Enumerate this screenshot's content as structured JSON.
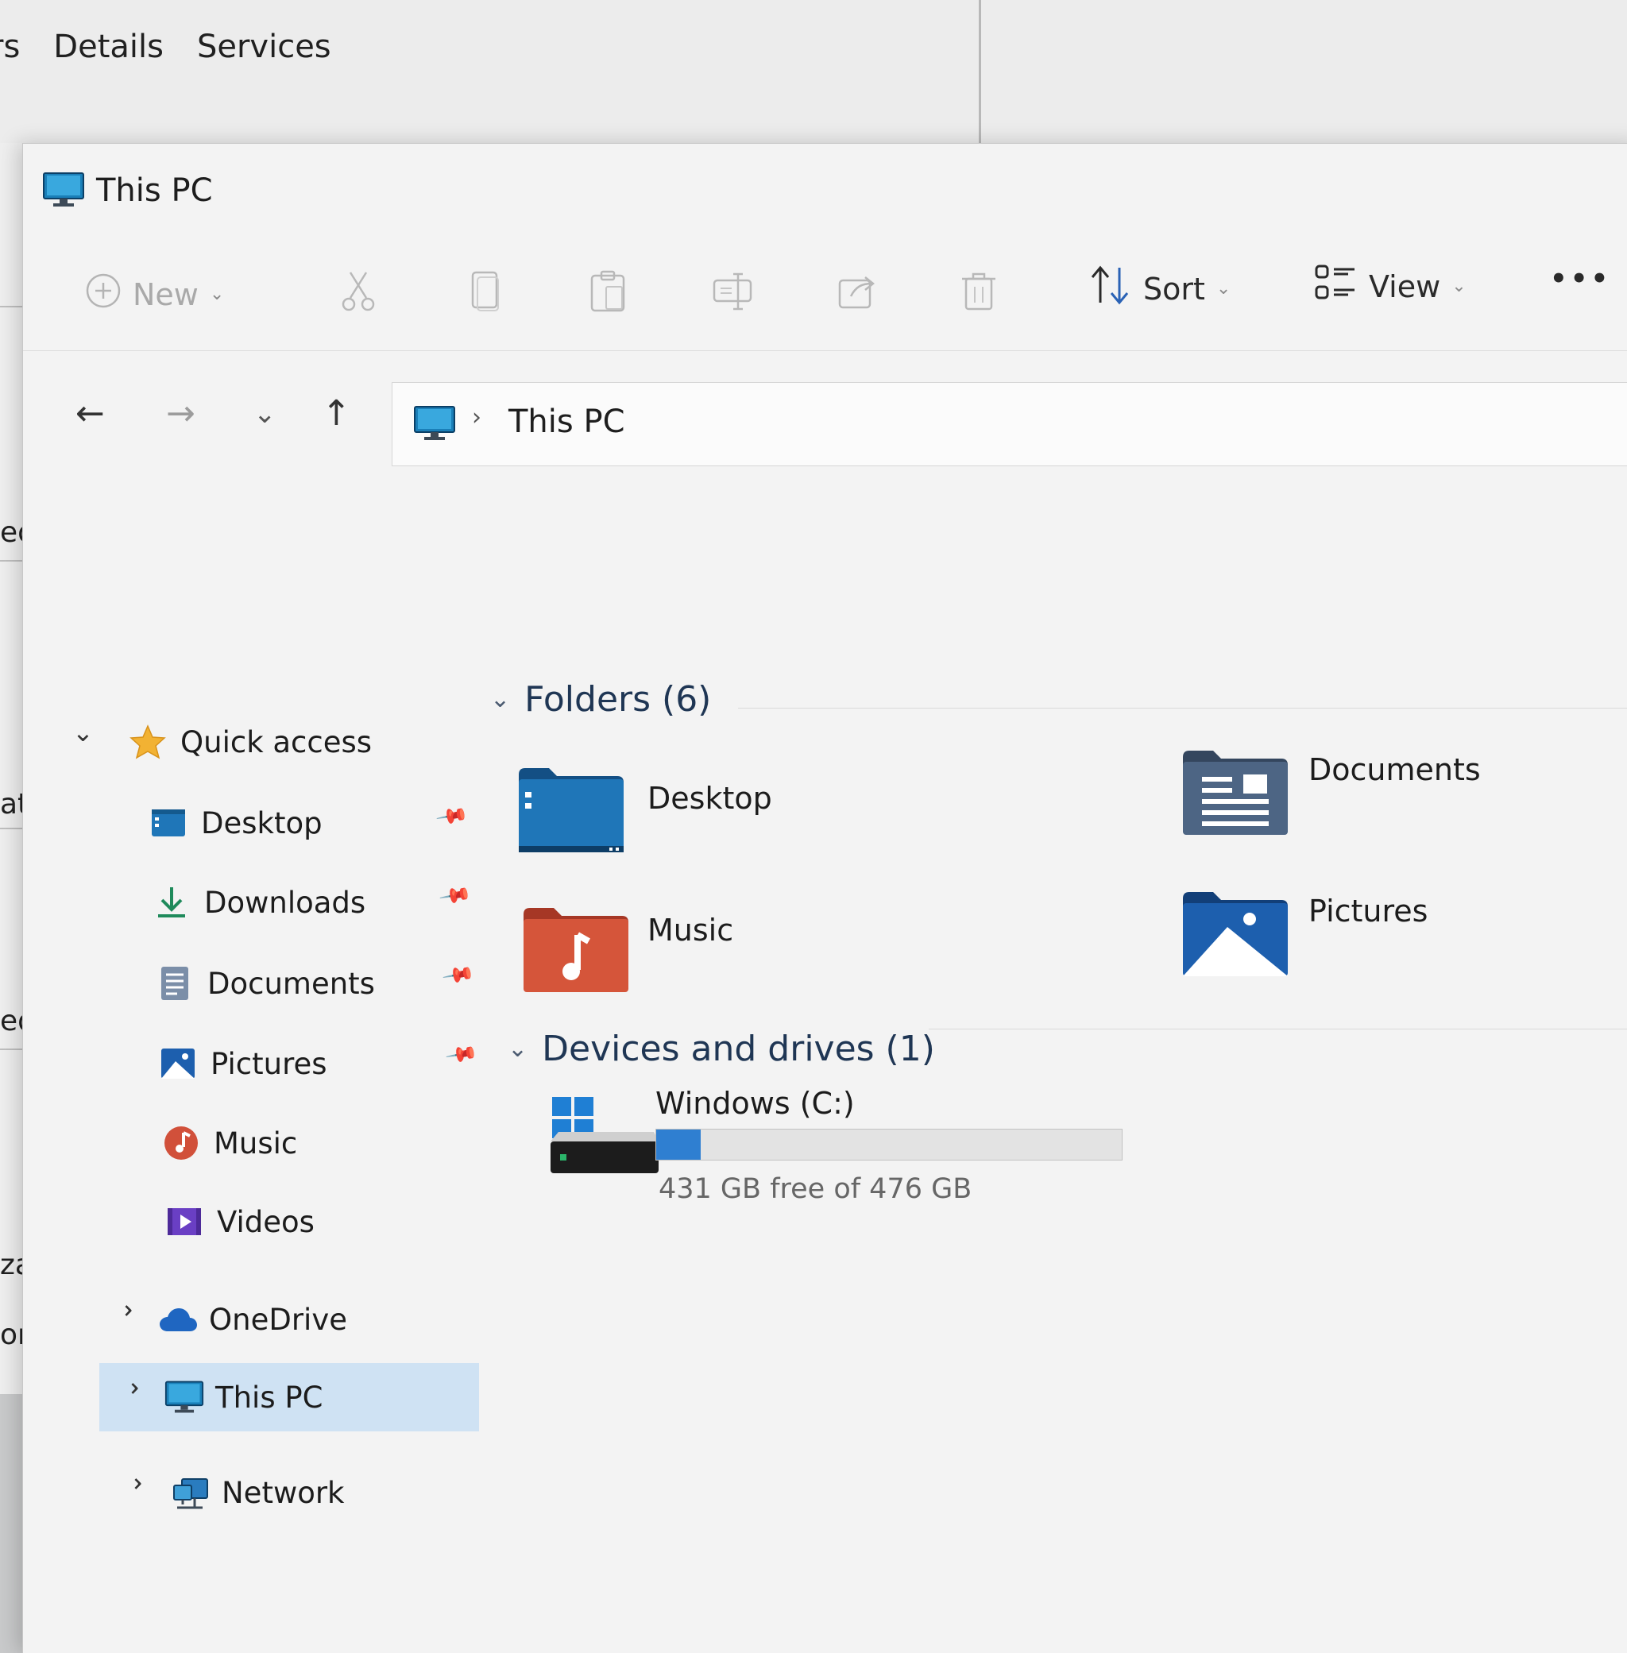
{
  "taskmgr": {
    "tabs": [
      "rs",
      "Details",
      "Services"
    ],
    "fragments": [
      "eo l",
      "ated",
      "ed GPl",
      "zation",
      "or"
    ]
  },
  "window": {
    "title": "This PC"
  },
  "toolbar": {
    "new_label": "New",
    "sort_label": "Sort",
    "view_label": "View",
    "more_label": "•••"
  },
  "nav": {
    "back": "←",
    "forward": "→",
    "recent": "⌄",
    "up": "↑",
    "separator": "›",
    "address": "This PC"
  },
  "sidebar": {
    "quick_access": "Quick access",
    "items": [
      {
        "label": "Desktop",
        "pinned": true
      },
      {
        "label": "Downloads",
        "pinned": true
      },
      {
        "label": "Documents",
        "pinned": true
      },
      {
        "label": "Pictures",
        "pinned": true
      },
      {
        "label": "Music",
        "pinned": false
      },
      {
        "label": "Videos",
        "pinned": false
      }
    ],
    "onedrive": "OneDrive",
    "thispc": "This PC",
    "network": "Network"
  },
  "content": {
    "folders_header": "Folders (6)",
    "folders": [
      {
        "label": "Desktop"
      },
      {
        "label": "Documents"
      },
      {
        "label": "Music"
      },
      {
        "label": "Pictures"
      }
    ],
    "devices_header": "Devices and drives (1)",
    "drive": {
      "name": "Windows (C:)",
      "free_text": "431 GB free of 476 GB",
      "used_fraction": 0.095
    }
  },
  "colors": {
    "accent": "#2f7fd1",
    "selection": "#cfe2f3",
    "desktop_folder": "#1f76b8",
    "music_folder": "#d5553a",
    "documents_folder": "#4d6584",
    "pictures_folder": "#1d5fae"
  }
}
